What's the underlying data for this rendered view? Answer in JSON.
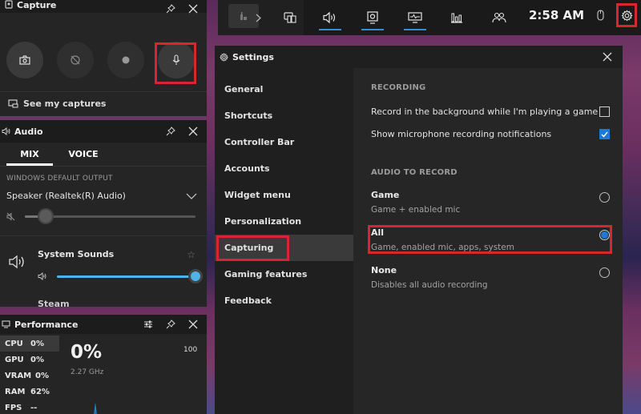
{
  "capture": {
    "title": "Capture",
    "buttons": [
      {
        "name": "screenshot",
        "icon": "camera-icon"
      },
      {
        "name": "record-last",
        "icon": "record-last-icon"
      },
      {
        "name": "start-recording",
        "icon": "record-dot-icon"
      },
      {
        "name": "microphone",
        "icon": "microphone-icon"
      }
    ],
    "see_captures": "See my captures"
  },
  "audio": {
    "title": "Audio",
    "tabs": [
      {
        "label": "MIX",
        "active": true
      },
      {
        "label": "VOICE",
        "active": false
      }
    ],
    "output_label": "WINDOWS DEFAULT OUTPUT",
    "device": "Speaker (Realtek(R) Audio)",
    "master_volume": 0.12,
    "master_muted": true,
    "apps": [
      {
        "name": "System Sounds",
        "volume": 1.0,
        "favorite": false
      },
      {
        "name": "Steam"
      }
    ]
  },
  "performance": {
    "title": "Performance",
    "metrics": [
      {
        "key": "CPU",
        "value": "0%",
        "active": true
      },
      {
        "key": "GPU",
        "value": "0%"
      },
      {
        "key": "VRAM",
        "value": "0%"
      },
      {
        "key": "RAM",
        "value": "62%"
      },
      {
        "key": "FPS",
        "value": "--"
      }
    ],
    "big_value": "0%",
    "sub_value": "2.27 GHz",
    "max_label": "100"
  },
  "topbar": {
    "time": "2:58 AM",
    "items": [
      "home-icon",
      "chevron-right-icon",
      "widget-menu-icon",
      "audio-icon",
      "capture-icon",
      "performance-icon",
      "resources-icon",
      "social-icon",
      "mouse-icon",
      "gear-icon"
    ]
  },
  "settings": {
    "title": "Settings",
    "nav": [
      {
        "label": "General"
      },
      {
        "label": "Shortcuts"
      },
      {
        "label": "Controller Bar"
      },
      {
        "label": "Accounts"
      },
      {
        "label": "Widget menu"
      },
      {
        "label": "Personalization"
      },
      {
        "label": "Capturing",
        "active": true
      },
      {
        "label": "Gaming features"
      },
      {
        "label": "Feedback"
      }
    ],
    "recording": {
      "title": "RECORDING",
      "options": [
        {
          "label": "Record in the background while I'm playing a game",
          "checked": false
        },
        {
          "label": "Show microphone recording notifications",
          "checked": true
        }
      ]
    },
    "audio_to_record": {
      "title": "AUDIO TO RECORD",
      "options": [
        {
          "title": "Game",
          "desc": "Game + enabled mic",
          "selected": false
        },
        {
          "title": "All",
          "desc": "Game, enabled mic, apps, system",
          "selected": true
        },
        {
          "title": "None",
          "desc": "Disables all audio recording",
          "selected": false
        }
      ]
    }
  },
  "colors": {
    "accent": "#1f7ad6",
    "slider_accent": "#4fb3ea",
    "highlight": "#d8262f"
  }
}
